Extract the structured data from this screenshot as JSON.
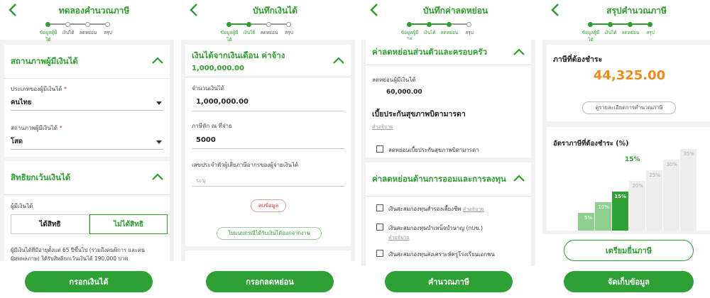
{
  "colors": {
    "primary": "#2ea135",
    "accent_orange": "#f08a1a",
    "required": "#d22"
  },
  "step_labels": [
    "ข้อมูลผู้มีได้",
    "เงินได้",
    "ลดหย่อน",
    "สรุป"
  ],
  "screen1": {
    "title": "ทดลองคำนวณภาษี",
    "active_step": 1,
    "section1_title": "สถานภาพผู้มีเงินได้",
    "type_label": "ประเภทของผู้มีเงินได้",
    "type_value": "คนไทย",
    "status_label": "สถานภาพผู้มีเงินได้",
    "status_value": "โสด",
    "required_mark": "*",
    "section2_title": "สิทธิยกเว้นเงินได้",
    "elderly_label": "ผู้มีเงินได้",
    "option_yes": "ได้สิทธิ",
    "option_no": "ไม่ได้สิทธิ",
    "selected_option": "ไม่ได้สิทธิ",
    "note": "ผู้มีเงินได้ที่มีอายุตั้งแต่ 65 ปีขึ้นไป (รวมถึงคนพิการ และคน",
    "note2": "ผู้ทุพพลภาพ) ได้รับสิทธิยกเว้นเงินได้ 190,000 บาท",
    "button": "กรอกเงินได้"
  },
  "screen2": {
    "title": "บันทึกเงินได้",
    "active_step": 2,
    "section_title": "เงินได้จากเงินเดือน ค่าจ้าง",
    "section_total": "1,000,000.00",
    "amount_label": "จำนวนเงินได้",
    "amount_value": "1,000,000.00",
    "wht_label": "ภาษีหัก ณ ที่จ่าย",
    "wht_value": "5000",
    "taxid_label": "เลขประจำตัวผู้เสียภาษีอากรของผู้จ่ายเงินได้",
    "taxid_placeholder": "ระบุ",
    "delete_button": "ลบข้อมูล",
    "severance_button": "ใบแนบกรณีได้รับเงินได้ออกจากงาน",
    "button": "กรอกลดหย่อน"
  },
  "screen3": {
    "title": "บันทึกค่าลดหย่อน",
    "active_step": 3,
    "section1_title": "ค่าลดหย่อนส่วนตัวและครอบครัว",
    "personal_label": "ลดหย่อนผู้มีเงินได้",
    "personal_value": "60,000.00",
    "parent_ins_title": "เบี้ยประกันสุขภาพบิดามารดา",
    "explain_link": "คำอธิบาย",
    "parent_ins_check": "ลดหย่อนเบี้ยประกันสุขภาพบิดามารดา",
    "section2_title": "ค่าลดหย่อนด้านการออมและการลงทุน",
    "items": [
      {
        "label": "เงินสะสมกองทุนสำรองเลี้ยงชีพ",
        "link": "คำอธิบาย"
      },
      {
        "label": "เงินสะสมกองทุนบำเหน็จบำนาญ (กบข.)",
        "link": "คำอธิบาย"
      },
      {
        "label": "เงินสะสมกองทุนสงเคราะห์ครูโรงเรียนเอกชน",
        "link": ""
      }
    ],
    "button": "คำนวณภาษี"
  },
  "screen4": {
    "title": "สรุปคำนวณภาษี",
    "active_step": 4,
    "tax_label": "ภาษีที่ต้องชำระ",
    "tax_value": "44,325.00",
    "detail_button": "ดูรายละเอียดการคำนวณภาษี",
    "rate_label": "อัตราภาษีที่ต้องชำระ (%)",
    "rate_value": "15%",
    "rates": [
      "5%",
      "10%",
      "15%",
      "20%",
      "25%",
      "30%",
      "35%"
    ],
    "active_rate_index": 2,
    "prepare_button": "เตรียมยื่นภาษี",
    "button": "จัดเก็บข้อมูล"
  }
}
